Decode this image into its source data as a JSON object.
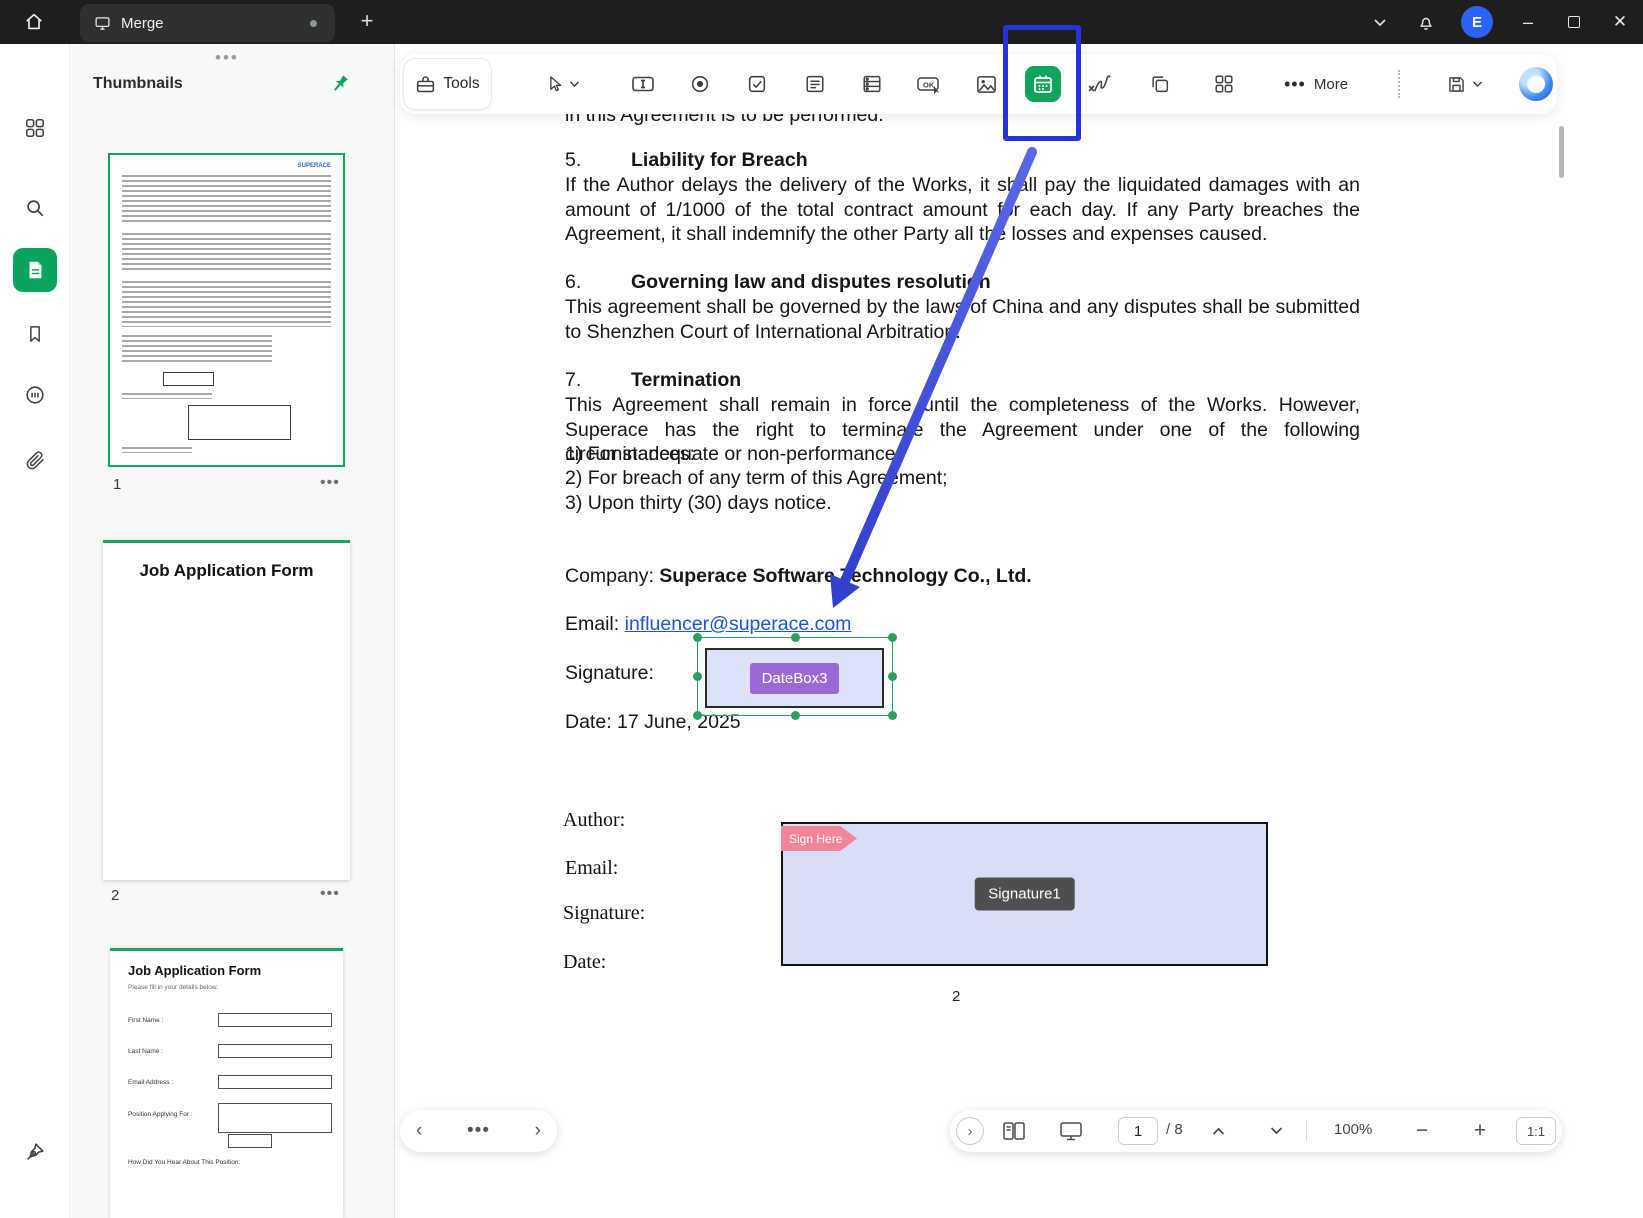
{
  "window": {
    "tab_title": "Merge",
    "avatar_initial": "E"
  },
  "thumbnails": {
    "panel_title": "Thumbnails",
    "page1_number": "1",
    "page2_number": "2",
    "thumb1_logo": "SUPERACE",
    "page2_title": "Job Application Form",
    "page3_title": "Job Application Form",
    "page3_subtitle": "Please fill in your details below.",
    "page3_fields": [
      "First Name :",
      "Last Name :",
      "Email Address :",
      "Position Applying For :"
    ],
    "page3_footer": "How Did You Hear About This Position:"
  },
  "toolbar": {
    "tools_label": "Tools",
    "more_label": "More",
    "ok_glyph": "OK"
  },
  "document": {
    "clipped_line": "in this Agreement is to be performed.",
    "sec5_num": "5.",
    "sec5_title": "Liability for Breach",
    "sec5_body": "If the Author delays the delivery of the Works, it shall pay the liquidated damages with an amount of 1/1000 of the total contract amount for each day. If any Party breaches the Agreement, it shall indemnify the other Party all the losses and expenses caused.",
    "sec6_num": "6.",
    "sec6_title": "Governing law and disputes resolution",
    "sec6_body": "This agreement shall be governed by the laws of China and any disputes shall be submitted to Shenzhen Court of International Arbitration.",
    "sec7_num": "7.",
    "sec7_title": "Termination",
    "sec7_body": "This Agreement shall remain in force until the completeness of the Works. However, Superace has the right to terminate the Agreement under one of the following circumstances:",
    "sec7_item1": "1) For inadequate or non-performance;",
    "sec7_item2": "2) For breach of any term of this Agreement;",
    "sec7_item3": "3)  Upon thirty (30) days notice.",
    "company_label": "Company:",
    "company_value": "Superace Software Technology Co., Ltd.",
    "email_label": "Email:",
    "email_link": "influencer@superace.com",
    "signature_label": "Signature:",
    "datebox_label": "DateBox3",
    "date_line": "Date: 17 June, 2025",
    "author_label": "Author:",
    "email2_label": "Email:",
    "signature2_label": "Signature:",
    "date2_label": "Date:",
    "sign_here_label": "Sign Here",
    "signature_field_label": "Signature1",
    "page_footer_number": "2"
  },
  "statusbar": {
    "page_current": "1",
    "page_total": "/ 8",
    "zoom_level": "100%",
    "fit_ratio": "1:1"
  },
  "colors": {
    "accent_green": "#0aa360",
    "highlight_blue": "#2433da",
    "link_blue": "#1a56d6",
    "datebox_purple": "#9a6ad4",
    "signhere_pink": "#f2849b"
  }
}
